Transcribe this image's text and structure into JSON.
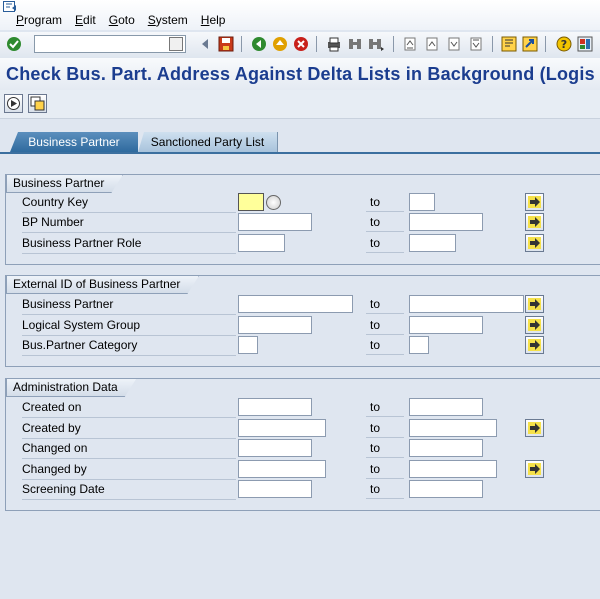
{
  "menu": {
    "items": [
      "Program",
      "Edit",
      "Goto",
      "System",
      "Help"
    ]
  },
  "toolbar": {
    "command_value": "",
    "icons": [
      "enter-icon",
      "back-icon",
      "save-icon",
      "back-green-icon",
      "exit-icon",
      "cancel-icon",
      "print-icon",
      "find-icon",
      "find-next-icon",
      "first-page-icon",
      "previous-page-icon",
      "next-page-icon",
      "last-page-icon",
      "new-session-icon",
      "shortcut-icon",
      "help-icon",
      "layout-icon"
    ]
  },
  "title": "Check Bus. Part. Address Against Delta Lists in Background (Logis",
  "tabs": {
    "tab1": "Business Partner",
    "tab2": "Sanctioned Party List"
  },
  "sections": {
    "bp": {
      "title": "Business Partner",
      "rows": [
        {
          "label": "Country Key",
          "to": "to",
          "from_value": "",
          "to_value": ""
        },
        {
          "label": "BP Number",
          "to": "to",
          "from_value": "",
          "to_value": ""
        },
        {
          "label": "Business Partner Role",
          "to": "to",
          "from_value": "",
          "to_value": ""
        }
      ]
    },
    "ext": {
      "title": "External ID of Business Partner",
      "rows": [
        {
          "label": "Business Partner",
          "to": "to",
          "from_value": "",
          "to_value": ""
        },
        {
          "label": "Logical System Group",
          "to": "to",
          "from_value": "",
          "to_value": ""
        },
        {
          "label": "Bus.Partner Category",
          "to": "to",
          "from_value": "",
          "to_value": ""
        }
      ]
    },
    "admin": {
      "title": "Administration Data",
      "rows": [
        {
          "label": "Created on",
          "to": "to",
          "from_value": "",
          "to_value": ""
        },
        {
          "label": "Created by",
          "to": "to",
          "from_value": "",
          "to_value": ""
        },
        {
          "label": "Changed on",
          "to": "to",
          "from_value": "",
          "to_value": ""
        },
        {
          "label": "Changed by",
          "to": "to",
          "from_value": "",
          "to_value": ""
        },
        {
          "label": "Screening Date",
          "to": "to",
          "from_value": "",
          "to_value": ""
        }
      ]
    }
  },
  "colors": {
    "title": "#1b3d8f",
    "tab_active": "#2f6a9e",
    "required_field": "#ffff9a",
    "background": "#dfe6f0"
  }
}
